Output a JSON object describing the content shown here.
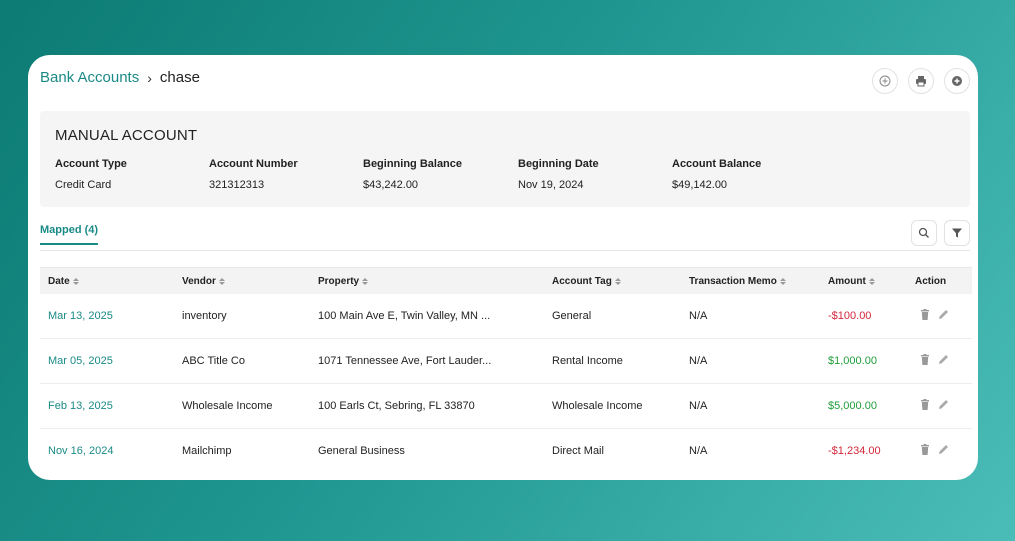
{
  "breadcrumb": {
    "parent": "Bank Accounts",
    "current": "chase"
  },
  "header_actions": [
    "add-icon",
    "print-icon",
    "add-circle-icon"
  ],
  "account": {
    "title": "MANUAL ACCOUNT",
    "fields": [
      {
        "label": "Account Type",
        "value": "Credit Card"
      },
      {
        "label": "Account Number",
        "value": "321312313"
      },
      {
        "label": "Beginning Balance",
        "value": "$43,242.00"
      },
      {
        "label": "Beginning Date",
        "value": "Nov 19, 2024"
      },
      {
        "label": "Account Balance",
        "value": "$49,142.00"
      }
    ]
  },
  "tabs": {
    "mapped": "Mapped (4)"
  },
  "table": {
    "columns": [
      "Date",
      "Vendor",
      "Property",
      "Account Tag",
      "Transaction Memo",
      "Amount",
      "Action"
    ],
    "rows": [
      {
        "date": "Mar 13, 2025",
        "vendor": "inventory",
        "property": "100 Main Ave E, Twin Valley, MN ...",
        "tag": "General",
        "memo": "N/A",
        "amount": "-$100.00",
        "sign": "neg"
      },
      {
        "date": "Mar 05, 2025",
        "vendor": "ABC Title Co",
        "property": "1071 Tennessee Ave, Fort Lauder...",
        "tag": "Rental Income",
        "memo": "N/A",
        "amount": "$1,000.00",
        "sign": "pos"
      },
      {
        "date": "Feb 13, 2025",
        "vendor": "Wholesale Income",
        "property": "100 Earls Ct, Sebring, FL 33870",
        "tag": "Wholesale Income",
        "memo": "N/A",
        "amount": "$5,000.00",
        "sign": "pos"
      },
      {
        "date": "Nov 16, 2024",
        "vendor": "Mailchimp",
        "property": "General Business",
        "tag": "Direct Mail",
        "memo": "N/A",
        "amount": "-$1,234.00",
        "sign": "neg"
      }
    ]
  },
  "colors": {
    "accent": "#1a8a86",
    "negative": "#d4273a",
    "positive": "#1f9d3a"
  }
}
